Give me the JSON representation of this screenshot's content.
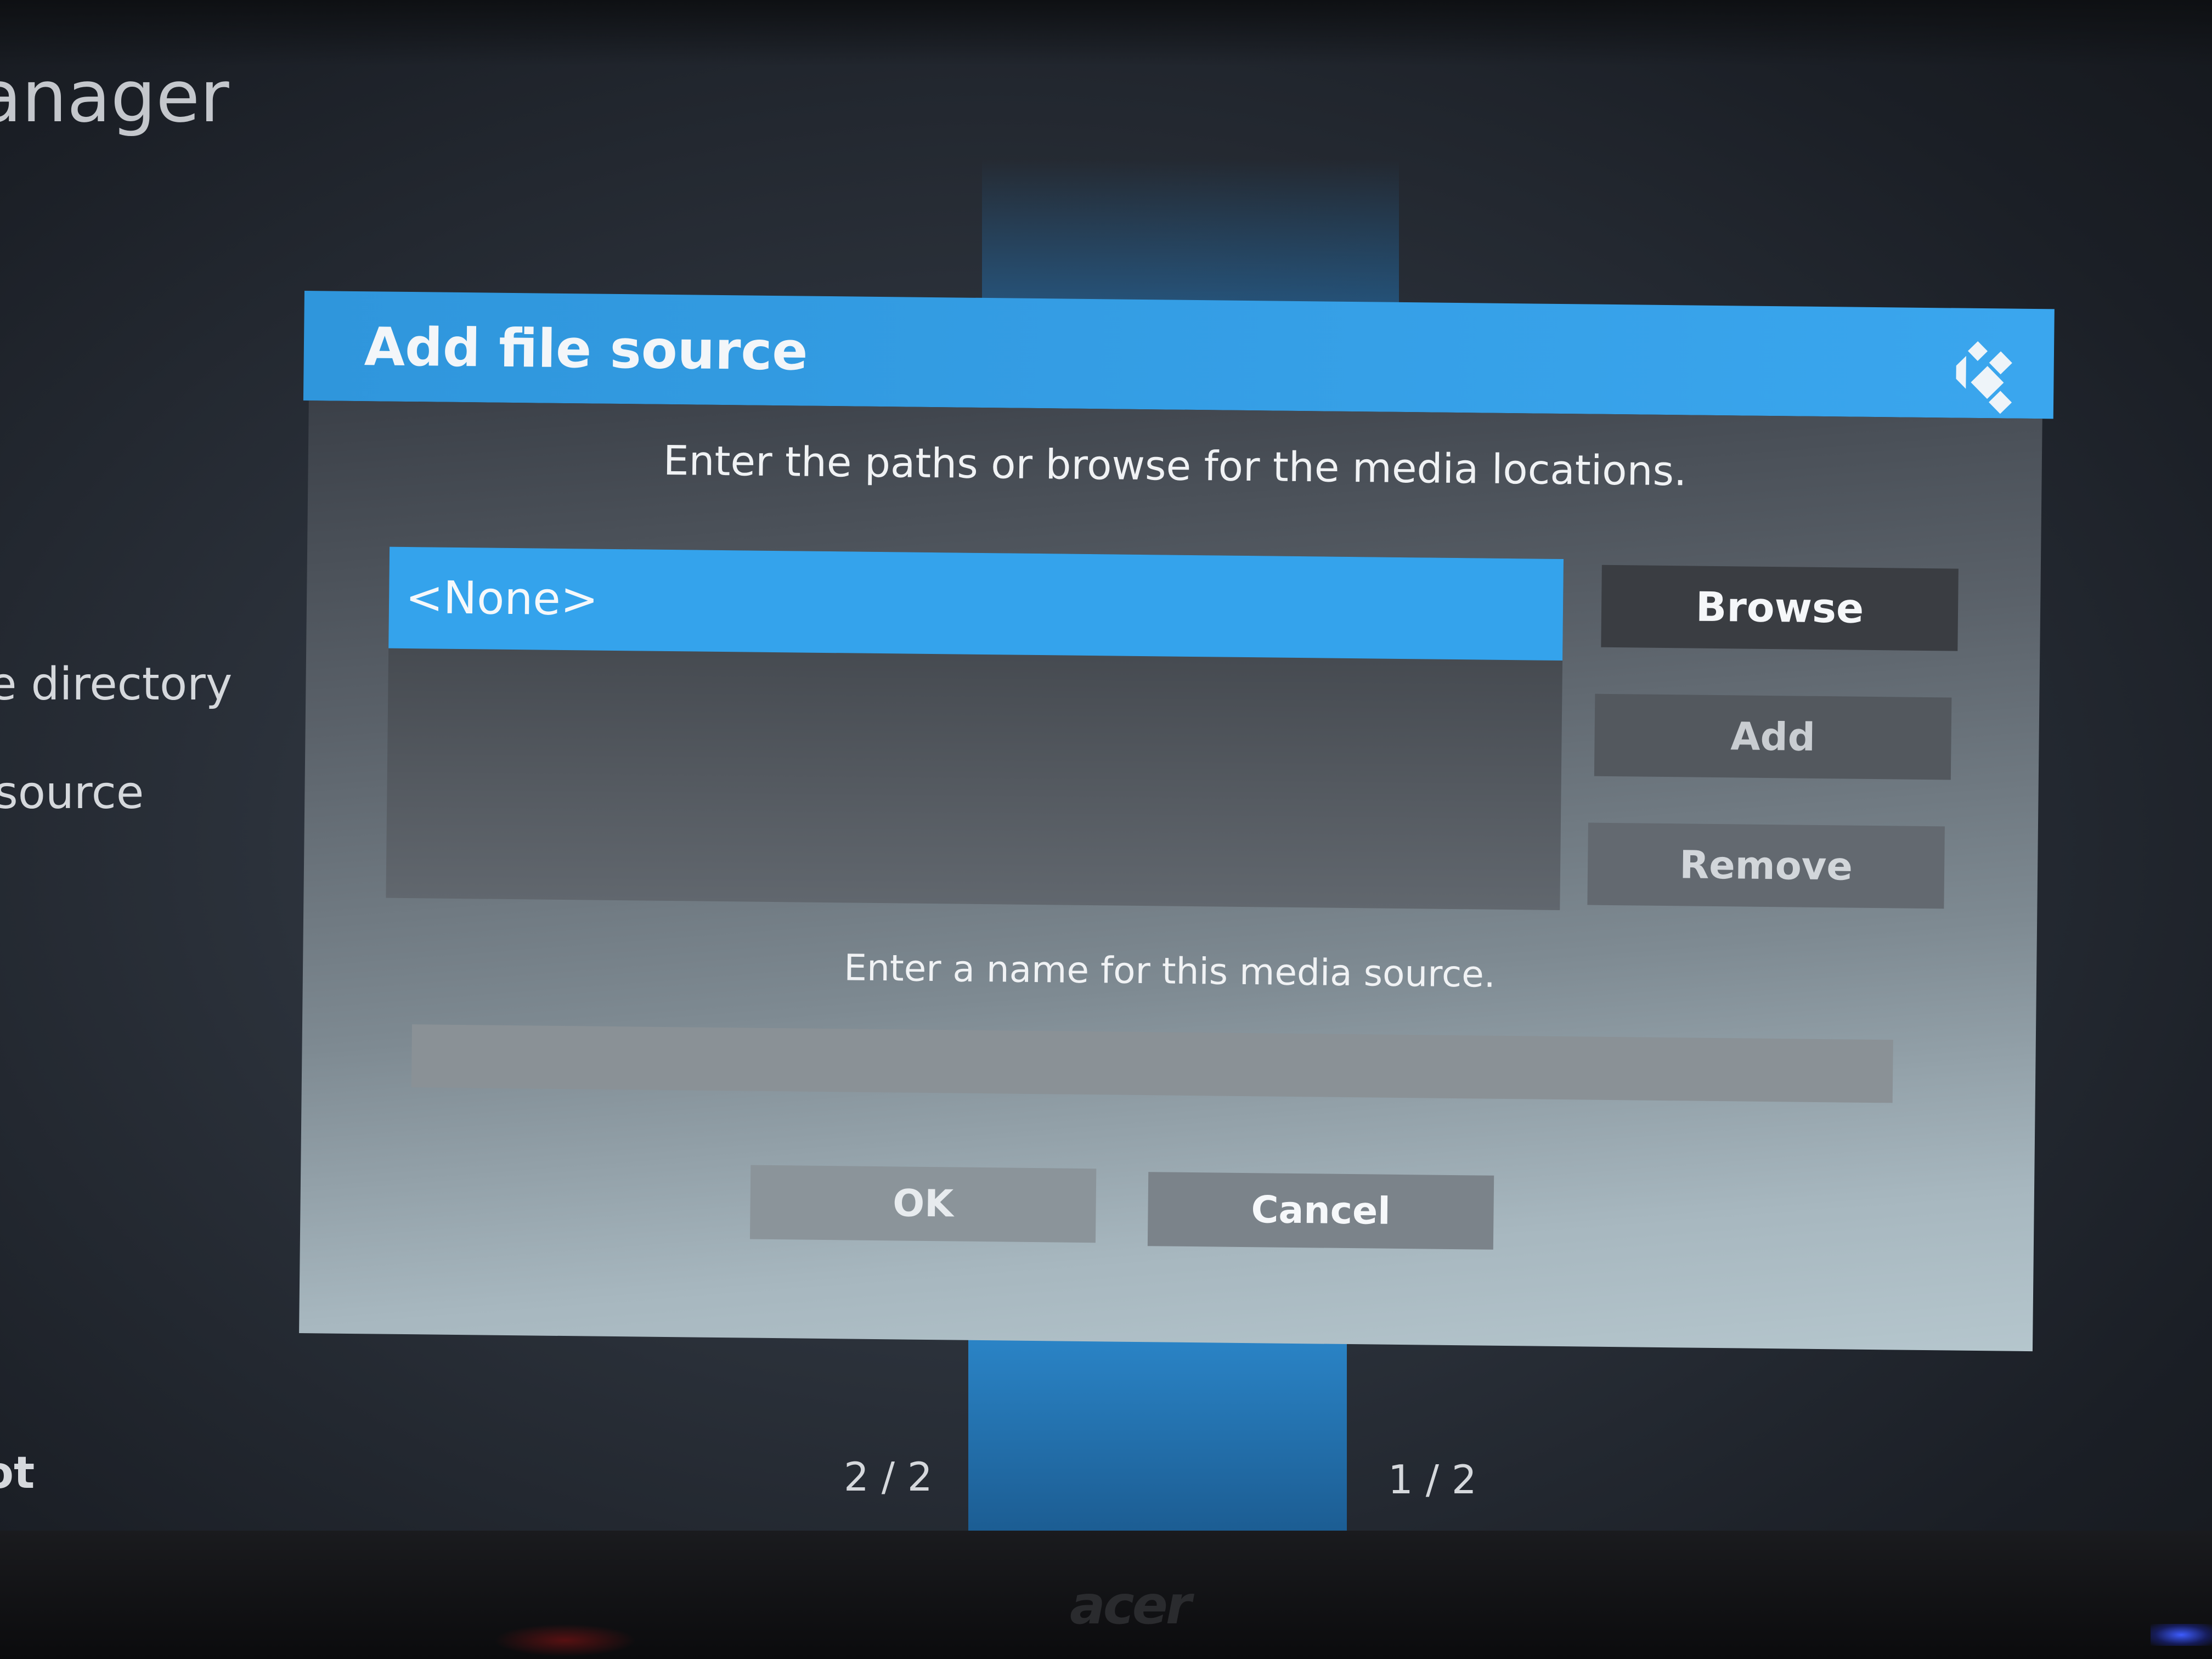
{
  "background": {
    "window_title_fragment": "anager",
    "menu_items": [
      "e directory",
      "source",
      "ot"
    ],
    "page_indicators": [
      "2 / 2",
      "1 / 2"
    ]
  },
  "dialog": {
    "title": "Add file source",
    "paths_instruction": "Enter the paths or browse for the media locations.",
    "path_list": [
      "<None>"
    ],
    "buttons": {
      "browse": "Browse",
      "add": "Add",
      "remove": "Remove"
    },
    "name_instruction": "Enter a name for this media source.",
    "name_value": "",
    "ok": "OK",
    "cancel": "Cancel",
    "logo_icon": "kodi-logo-icon"
  },
  "monitor": {
    "brand": "acer"
  },
  "colors": {
    "accent": "#34a3ec",
    "header": "#3aa6ee"
  }
}
